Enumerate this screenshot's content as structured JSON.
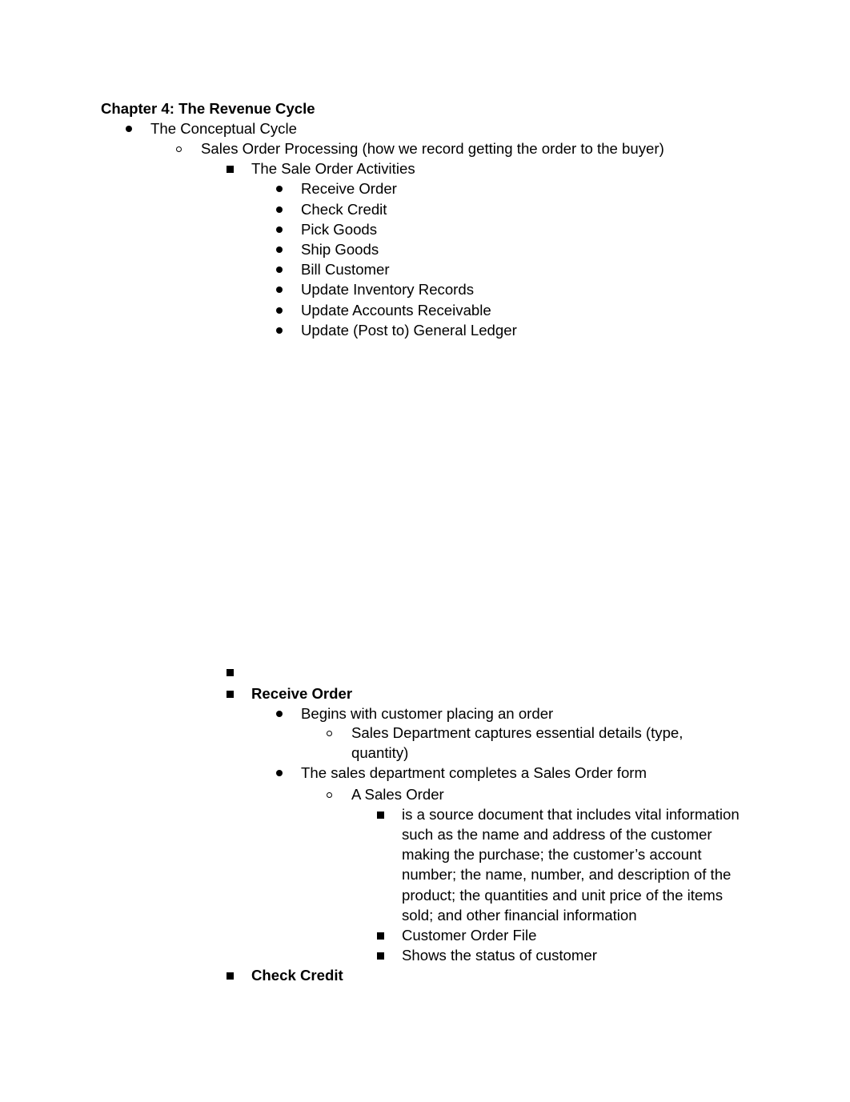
{
  "document": {
    "title": "Chapter 4: The Revenue Cycle",
    "conceptual_cycle": "The Conceptual Cycle",
    "sales_order_processing": "Sales Order Processing (how we record getting the order to the buyer)",
    "sale_order_activities": {
      "label": "The Sale Order Activities",
      "items": [
        "Receive Order",
        "Check Credit",
        "Pick Goods",
        "Ship Goods",
        "Bill Customer",
        "Update Inventory Records",
        "Update Accounts Receivable",
        "Update (Post to) General Ledger"
      ]
    },
    "empty_bullet": "",
    "receive_order": {
      "heading": "Receive Order",
      "begins": "Begins with customer placing an order",
      "captures_line1": "Sales Department captures essential details (type,",
      "captures_line2": "quantity)",
      "completes": "The sales department completes a Sales Order form",
      "a_sales_order": "A Sales Order",
      "definition_lines": [
        "is a source document that includes vital information",
        "such as the name and address of the customer",
        "making the purchase; the customer’s account",
        "number; the name, number, and description of the",
        "product; the quantities and unit price of the items",
        "sold; and other financial information"
      ],
      "customer_order_file": "Customer Order File",
      "shows_status": "Shows the status of customer"
    },
    "check_credit": {
      "heading": "Check Credit"
    }
  }
}
